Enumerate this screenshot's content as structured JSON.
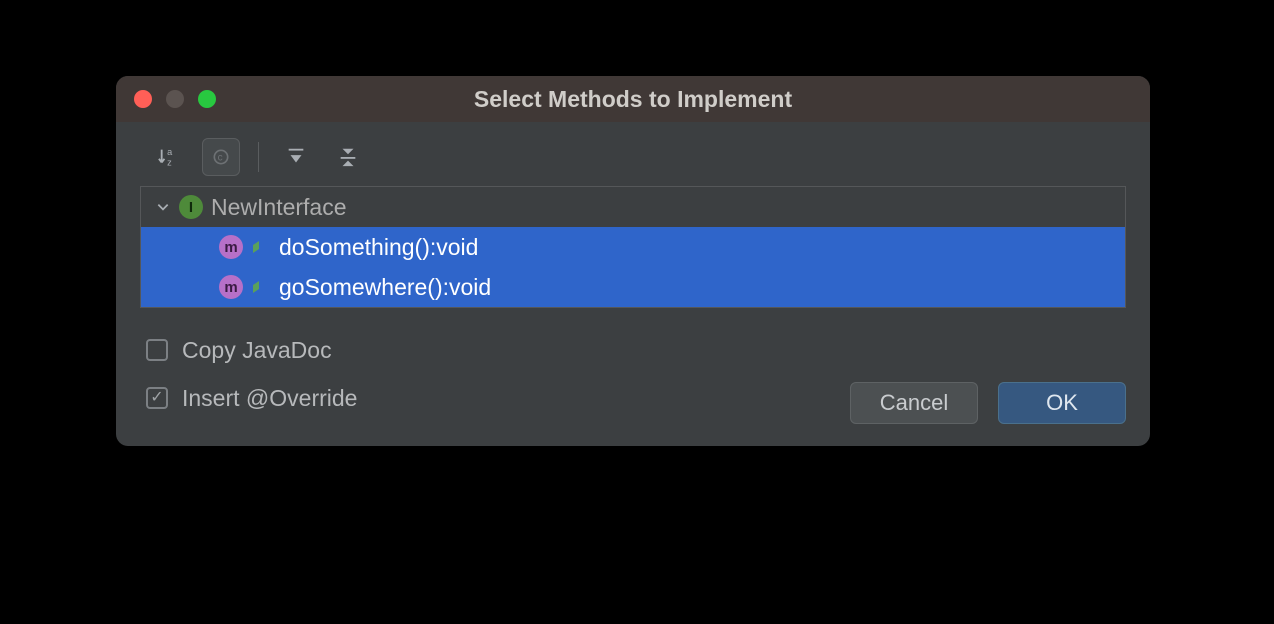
{
  "dialog": {
    "title": "Select Methods to Implement"
  },
  "toolbar": {
    "sort_icon": "sort-alpha-icon",
    "copy_icon": "copy-icon",
    "expand_icon": "expand-all-icon",
    "collapse_icon": "collapse-all-icon"
  },
  "tree": {
    "root": {
      "label": "NewInterface",
      "kind": "I"
    },
    "methods": [
      {
        "kind": "m",
        "label": "doSomething():void",
        "selected": true
      },
      {
        "kind": "m",
        "label": "goSomewhere():void",
        "selected": true
      }
    ]
  },
  "options": {
    "copy_javadoc": {
      "label": "Copy JavaDoc",
      "checked": false
    },
    "insert_override": {
      "label": "Insert @Override",
      "checked": true
    }
  },
  "buttons": {
    "cancel": "Cancel",
    "ok": "OK"
  }
}
